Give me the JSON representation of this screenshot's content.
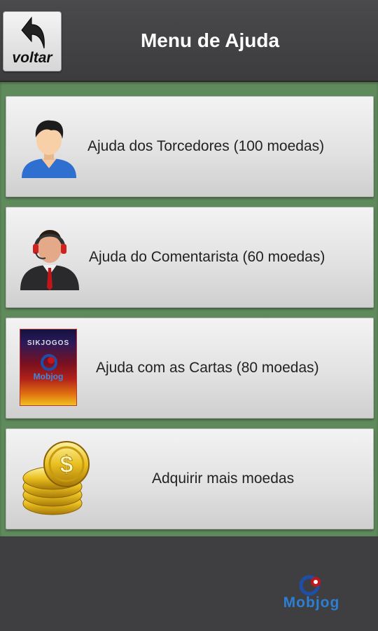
{
  "header": {
    "back_label": "voltar",
    "title": "Menu de Ajuda"
  },
  "menu": [
    {
      "label": "Ajuda dos Torcedores (100 moedas)",
      "icon": "fan-person-icon"
    },
    {
      "label": "Ajuda do Comentarista (60 moedas)",
      "icon": "commentator-headset-icon"
    },
    {
      "label": "Ajuda com as Cartas (80 moedas)",
      "icon": "card-deck-icon"
    },
    {
      "label": "Adquirir mais moedas",
      "icon": "coin-stack-icon"
    }
  ],
  "card_icon": {
    "top_text": "SIKJOGOS",
    "brand": "Mobjog"
  },
  "footer": {
    "brand": "Mobjog"
  },
  "colors": {
    "background": "#3f3f41",
    "panel": "#5f8a5c",
    "brand_blue": "#2d7fd3"
  }
}
